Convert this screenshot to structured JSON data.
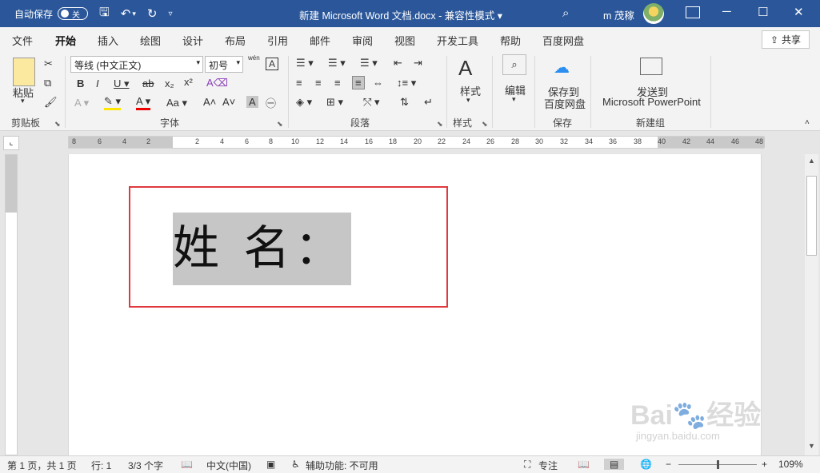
{
  "titlebar": {
    "autosave_label": "自动保存",
    "autosave_state": "关",
    "doc_title": "新建 Microsoft Word 文档.docx  -  兼容性模式 ▾",
    "user": "m 茂稼"
  },
  "menu": {
    "tabs": [
      "文件",
      "开始",
      "插入",
      "绘图",
      "设计",
      "布局",
      "引用",
      "邮件",
      "审阅",
      "视图",
      "开发工具",
      "帮助",
      "百度网盘"
    ],
    "share_label": "共享"
  },
  "ribbon": {
    "clipboard": {
      "paste_label": "粘贴",
      "group_label": "剪贴板"
    },
    "font": {
      "font_name": "等线 (中文正文)",
      "font_size": "初号",
      "group_label": "字体",
      "pinyin": "wén"
    },
    "paragraph": {
      "group_label": "段落"
    },
    "styles": {
      "label": "样式",
      "group_label": "样式"
    },
    "editing": {
      "label": "编辑"
    },
    "save": {
      "label_line1": "保存到",
      "label_line2": "百度网盘",
      "group_label": "保存"
    },
    "send": {
      "label_line1": "发送到",
      "label_line2": "Microsoft PowerPoint",
      "group_label": "新建组"
    }
  },
  "document": {
    "text": "姓 名："
  },
  "statusbar": {
    "page": "第 1 页，共 1 页",
    "line": "行: 1",
    "words": "3/3 个字",
    "language": "中文(中国)",
    "accessibility": "辅助功能: 不可用",
    "focus": "专注",
    "zoom": "109%"
  },
  "watermark": {
    "main": "Bai🐾经验",
    "sub": "jingyan.baidu.com"
  },
  "colors": {
    "accent": "#2b579a",
    "highlight_box": "#e0393e",
    "selection": "#c6c6c6"
  }
}
